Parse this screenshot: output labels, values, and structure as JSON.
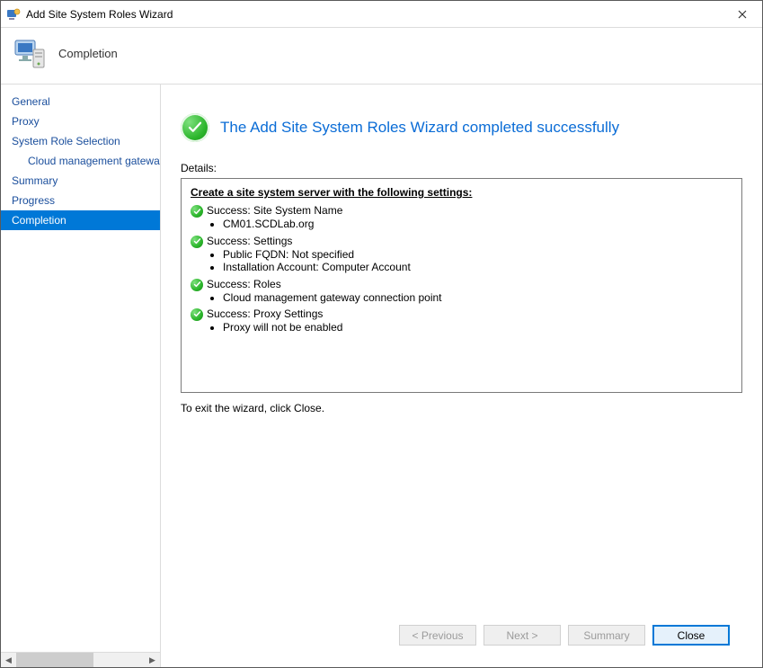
{
  "window": {
    "title": "Add Site System Roles Wizard"
  },
  "header": {
    "stage_title": "Completion"
  },
  "sidebar": {
    "items": [
      {
        "label": "General",
        "sub": false
      },
      {
        "label": "Proxy",
        "sub": false
      },
      {
        "label": "System Role Selection",
        "sub": false
      },
      {
        "label": "Cloud management gateway connection point",
        "sub": true
      },
      {
        "label": "Summary",
        "sub": false
      },
      {
        "label": "Progress",
        "sub": false
      },
      {
        "label": "Completion",
        "sub": false
      }
    ],
    "selected_index": 6
  },
  "content": {
    "success_heading": "The Add Site System Roles Wizard completed successfully",
    "details_label": "Details:",
    "box_heading": "Create a site system server with the following settings:",
    "sections": [
      {
        "title": "Success: Site System Name",
        "bullets": [
          "CM01.SCDLab.org"
        ]
      },
      {
        "title": "Success: Settings",
        "bullets": [
          "Public FQDN: Not specified",
          "Installation Account: Computer Account"
        ]
      },
      {
        "title": "Success: Roles",
        "bullets": [
          "Cloud management gateway connection point"
        ]
      },
      {
        "title": "Success: Proxy Settings",
        "bullets": [
          "Proxy will not be enabled"
        ]
      }
    ],
    "exit_hint": "To exit the wizard, click Close."
  },
  "footer": {
    "previous": "< Previous",
    "next": "Next >",
    "summary": "Summary",
    "close": "Close"
  }
}
